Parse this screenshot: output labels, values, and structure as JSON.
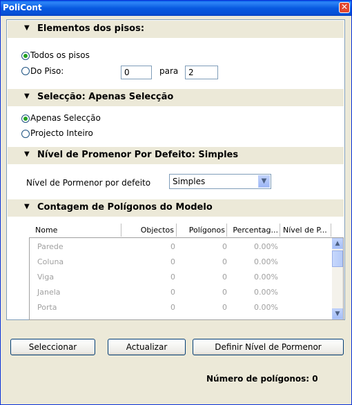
{
  "window": {
    "title": "PoliCont",
    "close_icon": "close-icon"
  },
  "sections": {
    "floors": {
      "title": "Elementos dos pisos:",
      "all_floors_label": "Todos os pisos",
      "from_floor_label": "Do Piso:",
      "from_value": "0",
      "to_label": "para",
      "to_value": "2",
      "selected": "all_floors"
    },
    "selection": {
      "title": "Selecção: Apenas Selecção",
      "only_selection_label": "Apenas Selecção",
      "whole_project_label": "Projecto Inteiro",
      "selected": "only_selection"
    },
    "detail": {
      "title": "Nível de Promenor Por Defeito: Simples",
      "field_label": "Nível de Pormenor por defeito",
      "value": "Simples"
    },
    "count": {
      "title": "Contagem de Polígonos do Modelo",
      "columns": [
        "Nome",
        "Objectos",
        "Polígonos",
        "Percentag...",
        "Nível de P..."
      ],
      "rows": [
        {
          "name": "Parede",
          "objects": "0",
          "polygons": "0",
          "percent": "0.00%",
          "level": ""
        },
        {
          "name": "Coluna",
          "objects": "0",
          "polygons": "0",
          "percent": "0.00%",
          "level": ""
        },
        {
          "name": "Viga",
          "objects": "0",
          "polygons": "0",
          "percent": "0.00%",
          "level": ""
        },
        {
          "name": "Janela",
          "objects": "0",
          "polygons": "0",
          "percent": "0.00%",
          "level": ""
        },
        {
          "name": "Porta",
          "objects": "0",
          "polygons": "0",
          "percent": "0.00%",
          "level": ""
        }
      ]
    }
  },
  "buttons": {
    "select": "Seleccionar",
    "update": "Actualizar",
    "define_level": "Definir Nível de Pormenor"
  },
  "status": {
    "polygon_count": "Número de polígonos: 0"
  }
}
